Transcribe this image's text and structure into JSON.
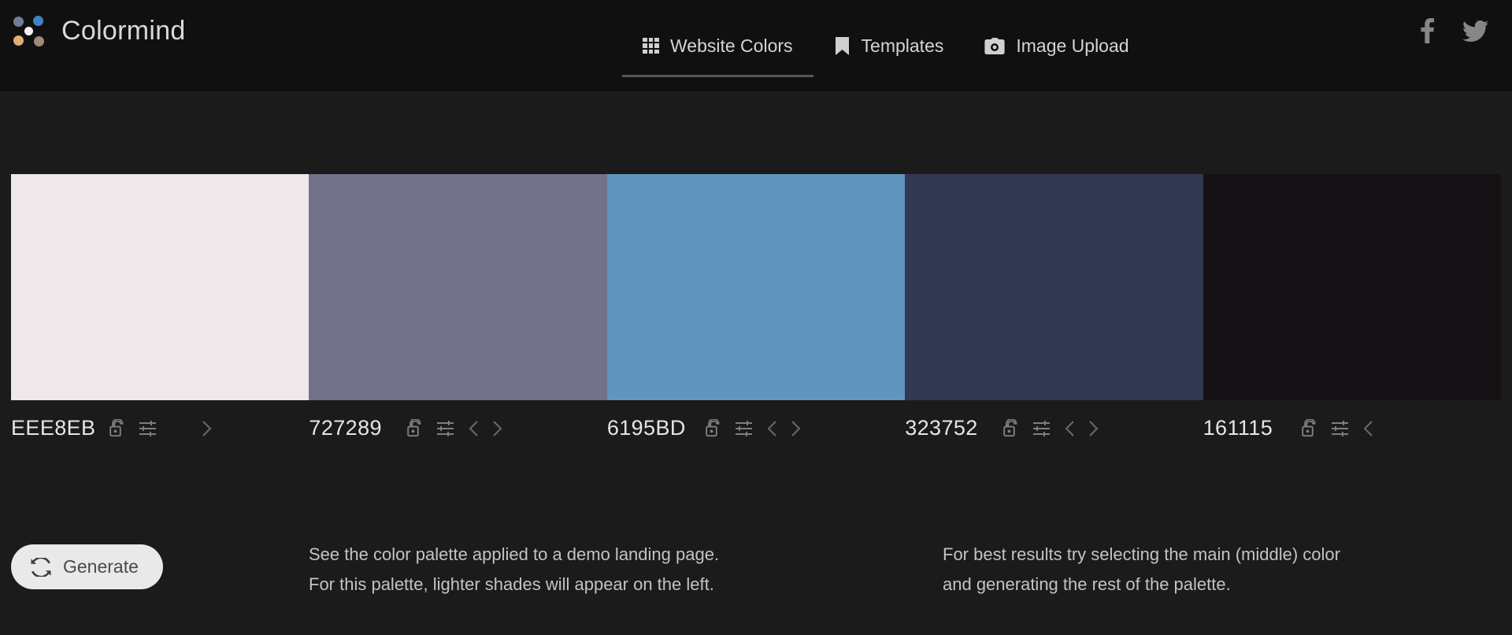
{
  "brand": {
    "name": "Colormind",
    "logo_icon": "colormind-dots-logo"
  },
  "nav": {
    "items": [
      {
        "label": "Website Colors",
        "icon": "grid-icon",
        "active": true
      },
      {
        "label": "Templates",
        "icon": "bookmark-icon",
        "active": false
      },
      {
        "label": "Image Upload",
        "icon": "camera-icon",
        "active": false
      }
    ]
  },
  "social": {
    "items": [
      {
        "name": "facebook-icon"
      },
      {
        "name": "twitter-icon"
      }
    ]
  },
  "palette": {
    "swatches": [
      {
        "hex": "EEE8EB",
        "color": "#EEE8EB",
        "lock_icon": "unlock-icon",
        "tune_icon": "tune-icon",
        "prev_icon": null,
        "next_icon": "chevron-right-icon"
      },
      {
        "hex": "727289",
        "color": "#727289",
        "lock_icon": "unlock-icon",
        "tune_icon": "tune-icon",
        "prev_icon": "chevron-left-icon",
        "next_icon": "chevron-right-icon"
      },
      {
        "hex": "6195BD",
        "color": "#6195BD",
        "lock_icon": "unlock-icon",
        "tune_icon": "tune-icon",
        "prev_icon": "chevron-left-icon",
        "next_icon": "chevron-right-icon"
      },
      {
        "hex": "323752",
        "color": "#323752",
        "lock_icon": "unlock-icon",
        "tune_icon": "tune-icon",
        "prev_icon": "chevron-left-icon",
        "next_icon": "chevron-right-icon"
      },
      {
        "hex": "161115",
        "color": "#161115",
        "lock_icon": "unlock-icon",
        "tune_icon": "tune-icon",
        "prev_icon": "chevron-left-icon",
        "next_icon": null
      }
    ]
  },
  "footer": {
    "generate_label": "Generate",
    "generate_icon": "refresh-icon",
    "note_left_line1": "See the color palette applied to a demo landing page.",
    "note_left_line2": "For this palette, lighter shades will appear on the left.",
    "note_right_line1": "For best results try selecting the main (middle) color",
    "note_right_line2": "and generating the rest of the palette."
  },
  "theme": {
    "header_bg": "#101010",
    "body_bg": "#1b1b1b",
    "text": "#d5d5d5",
    "accent_underline": "#55565a",
    "button_bg": "#e9e9e9"
  }
}
